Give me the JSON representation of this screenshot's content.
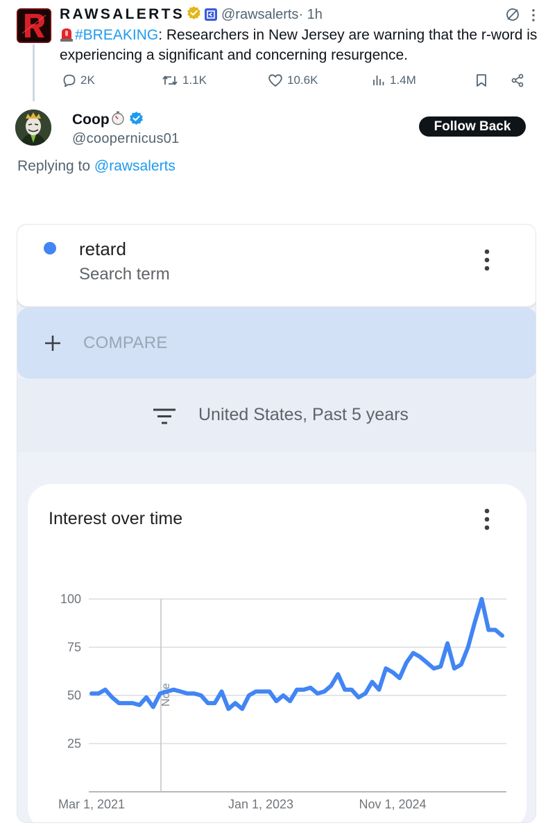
{
  "tweet": {
    "display_name": "RAWSALERTS",
    "handle": "@rawsalerts",
    "time": "· 1h",
    "text_hashtag": "#BREAKING",
    "text_body": ": Researchers in New Jersey are warning that the r-word is experiencing a significant and concerning resurgence.",
    "stats": {
      "replies": "2K",
      "reposts": "1.1K",
      "likes": "10.6K",
      "views": "1.4M"
    }
  },
  "reply": {
    "display_name": "Coop",
    "handle": "@coopernicus01",
    "follow_label": "Follow Back",
    "replying_prefix": "Replying to ",
    "replying_handle": "@rawsalerts"
  },
  "trends": {
    "term": "retard",
    "term_type": "Search term",
    "compare_label": "COMPARE",
    "filter_text": "United States, Past 5 years",
    "chart_title": "Interest over time"
  },
  "colors": {
    "series": "#4285f4",
    "link": "#1d9bf0",
    "compare_bg": "#d2e1f5"
  },
  "chart_data": {
    "type": "line",
    "title": "Interest over time",
    "xlabel": "",
    "ylabel": "",
    "ylim": [
      0,
      100
    ],
    "yticks": [
      25,
      50,
      75,
      100
    ],
    "xticks": [
      "Mar 1, 2021",
      "Jan 1, 2023",
      "Nov 1, 2024"
    ],
    "annotation": "Note",
    "grid": true,
    "series": [
      {
        "values": [
          51,
          51,
          53,
          49,
          46,
          46,
          46,
          45,
          49,
          44,
          51,
          52,
          53,
          52,
          51,
          51,
          50,
          46,
          46,
          52,
          43,
          46,
          43,
          50,
          52,
          52,
          52,
          47,
          50,
          47,
          53,
          53,
          54,
          51,
          52,
          55,
          61,
          53,
          53,
          49,
          51,
          57,
          53,
          64,
          62,
          59,
          67,
          72,
          70,
          67,
          64,
          65,
          77,
          64,
          66,
          75,
          88,
          100,
          84,
          84,
          81
        ]
      }
    ]
  }
}
